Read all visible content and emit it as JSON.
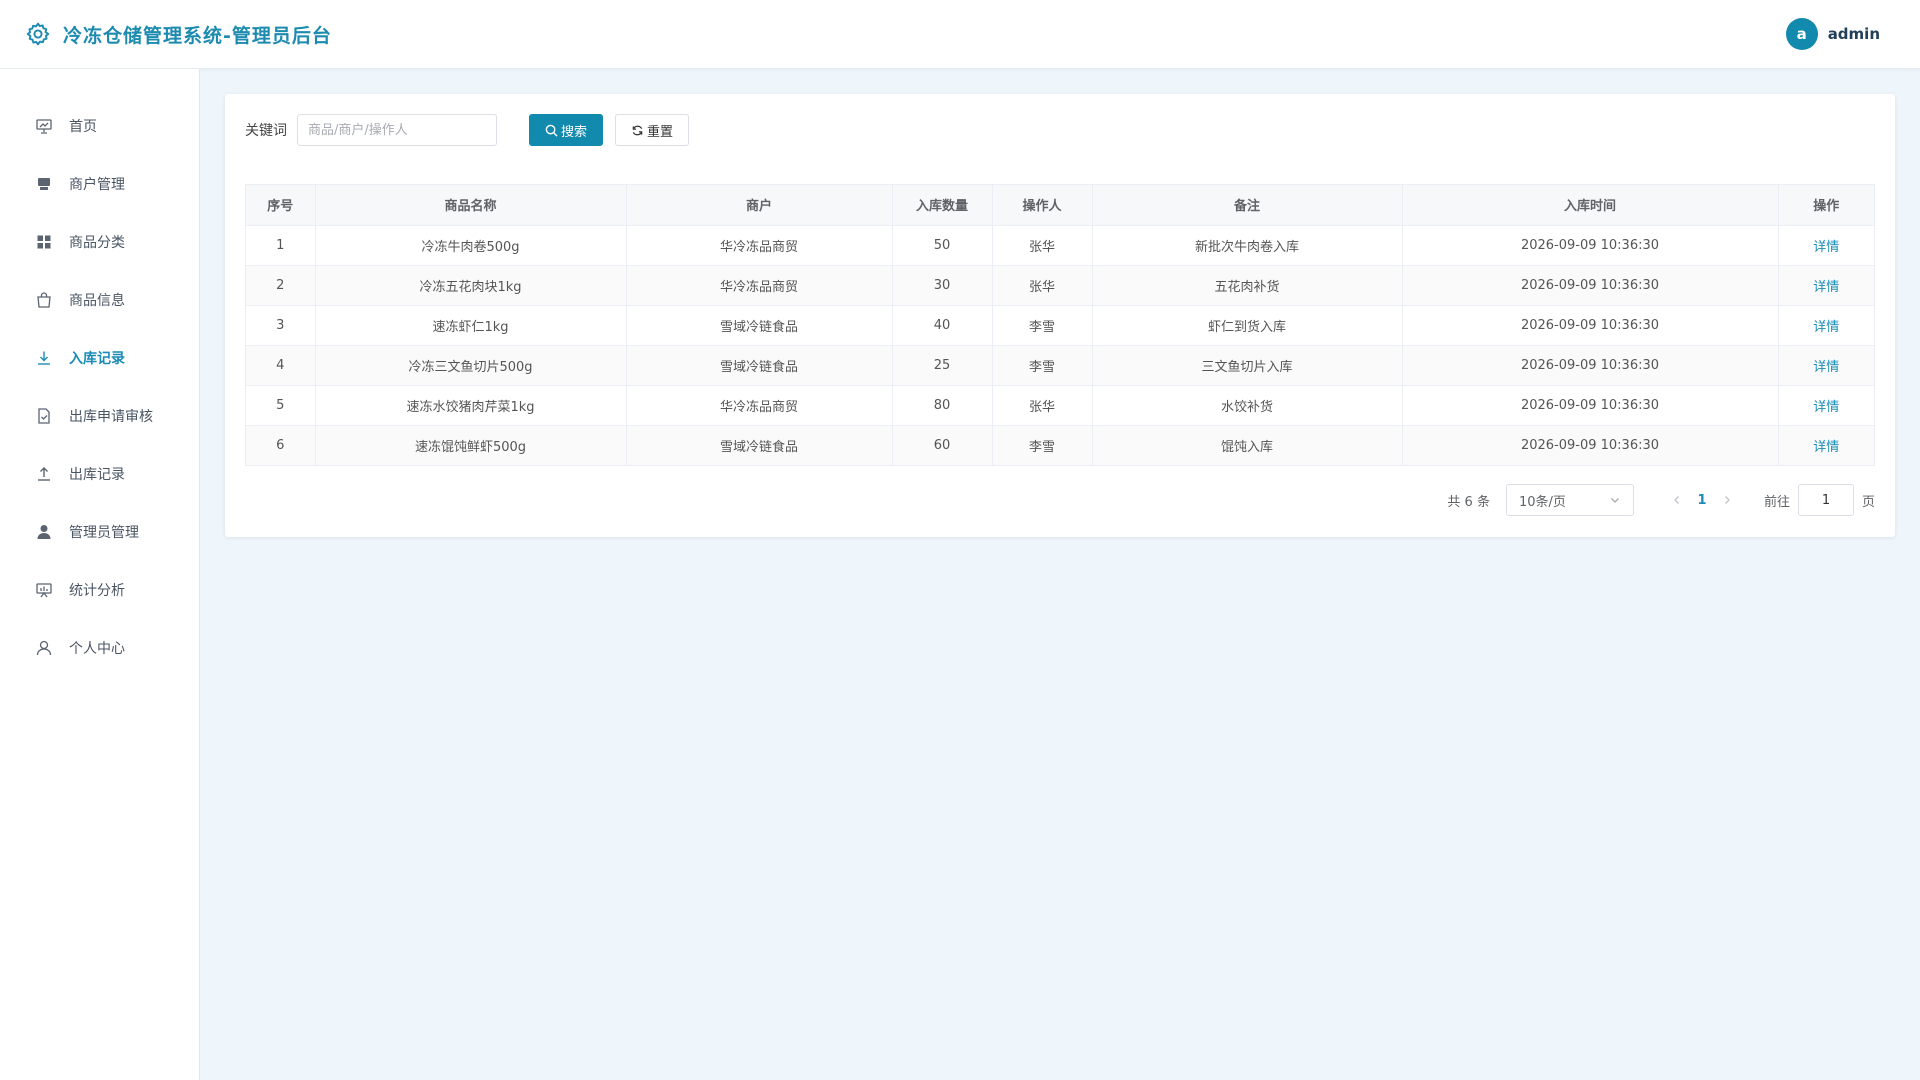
{
  "header": {
    "title": "冷冻仓储管理系统-管理员后台",
    "user_initial": "a",
    "username": "admin"
  },
  "sidebar": {
    "items": [
      {
        "label": "首页",
        "icon": "dashboard-icon"
      },
      {
        "label": "商户管理",
        "icon": "merchant-icon"
      },
      {
        "label": "商品分类",
        "icon": "grid-icon"
      },
      {
        "label": "商品信息",
        "icon": "shopping-bag-icon"
      },
      {
        "label": "入库记录",
        "icon": "download-icon",
        "active": true
      },
      {
        "label": "出库申请审核",
        "icon": "document-check-icon"
      },
      {
        "label": "出库记录",
        "icon": "upload-icon"
      },
      {
        "label": "管理员管理",
        "icon": "user-filled-icon"
      },
      {
        "label": "统计分析",
        "icon": "chart-board-icon"
      },
      {
        "label": "个人中心",
        "icon": "user-icon"
      }
    ]
  },
  "search": {
    "label": "关键词",
    "placeholder": "商品/商户/操作人",
    "search_button": "搜索",
    "reset_button": "重置"
  },
  "table": {
    "columns": [
      "序号",
      "商品名称",
      "商户",
      "入库数量",
      "操作人",
      "备注",
      "入库时间",
      "操作"
    ],
    "rows": [
      {
        "no": "1",
        "product": "冷冻牛肉卷500g",
        "merchant": "华冷冻品商贸",
        "qty": "50",
        "operator": "张华",
        "remark": "新批次牛肉卷入库",
        "time": "2026-09-09 10:36:30",
        "action": "详情"
      },
      {
        "no": "2",
        "product": "冷冻五花肉块1kg",
        "merchant": "华冷冻品商贸",
        "qty": "30",
        "operator": "张华",
        "remark": "五花肉补货",
        "time": "2026-09-09 10:36:30",
        "action": "详情"
      },
      {
        "no": "3",
        "product": "速冻虾仁1kg",
        "merchant": "雪域冷链食品",
        "qty": "40",
        "operator": "李雪",
        "remark": "虾仁到货入库",
        "time": "2026-09-09 10:36:30",
        "action": "详情"
      },
      {
        "no": "4",
        "product": "冷冻三文鱼切片500g",
        "merchant": "雪域冷链食品",
        "qty": "25",
        "operator": "李雪",
        "remark": "三文鱼切片入库",
        "time": "2026-09-09 10:36:30",
        "action": "详情"
      },
      {
        "no": "5",
        "product": "速冻水饺猪肉芹菜1kg",
        "merchant": "华冷冻品商贸",
        "qty": "80",
        "operator": "张华",
        "remark": "水饺补货",
        "time": "2026-09-09 10:36:30",
        "action": "详情"
      },
      {
        "no": "6",
        "product": "速冻馄饨鲜虾500g",
        "merchant": "雪域冷链食品",
        "qty": "60",
        "operator": "李雪",
        "remark": "馄饨入库",
        "time": "2026-09-09 10:36:30",
        "action": "详情"
      }
    ]
  },
  "pagination": {
    "total_text": "共 6 条",
    "page_size": "10条/页",
    "current_page": "1",
    "goto_label": "前往",
    "goto_value": "1",
    "page_unit": "页"
  },
  "colors": {
    "primary": "#128aad",
    "title": "#1d8bb0",
    "link": "#1a8cb6",
    "background": "#eef5fb"
  }
}
